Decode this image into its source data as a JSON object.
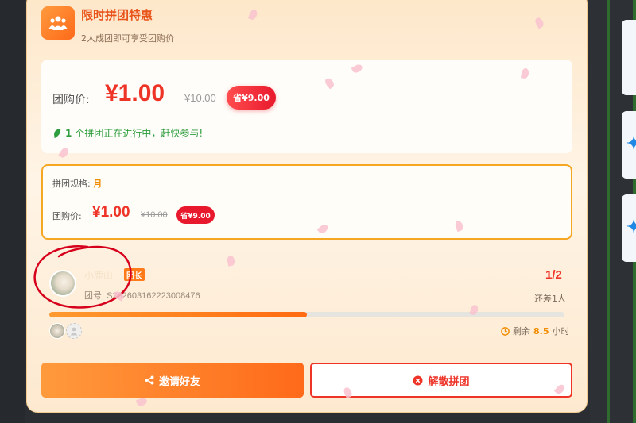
{
  "header": {
    "title": "限时拼团特惠",
    "subtitle": "2人成团即可享受团购价"
  },
  "price_card": {
    "label": "团购价:",
    "price": "¥1.00",
    "original_price": "¥10.00",
    "save_badge": "省¥9.00",
    "status_count": "1",
    "status_text": "个拼团正在进行中，赶快参与!"
  },
  "spec_card": {
    "spec_label": "拼团规格:",
    "spec_value": "月",
    "price_label": "团购价:",
    "price": "¥1.00",
    "original_price": "¥10.00",
    "save_badge": "省¥9.00"
  },
  "team": {
    "leader_name": "小鹿山",
    "leader_badge": "团长",
    "order_no": "团号: S202603162223008476",
    "progress": "1/2",
    "progress_fraction": 0.5,
    "remain": "还差1人",
    "time_prefix": "剩余",
    "time_value": "8.5",
    "time_unit": "小时"
  },
  "actions": {
    "invite_label": "邀请好友",
    "disband_label": "解散拼团"
  },
  "colors": {
    "accent": "#ff6a1a",
    "price_red": "#ee3327",
    "success_green": "#2e9d3d",
    "annotation_red": "#d6001c"
  }
}
